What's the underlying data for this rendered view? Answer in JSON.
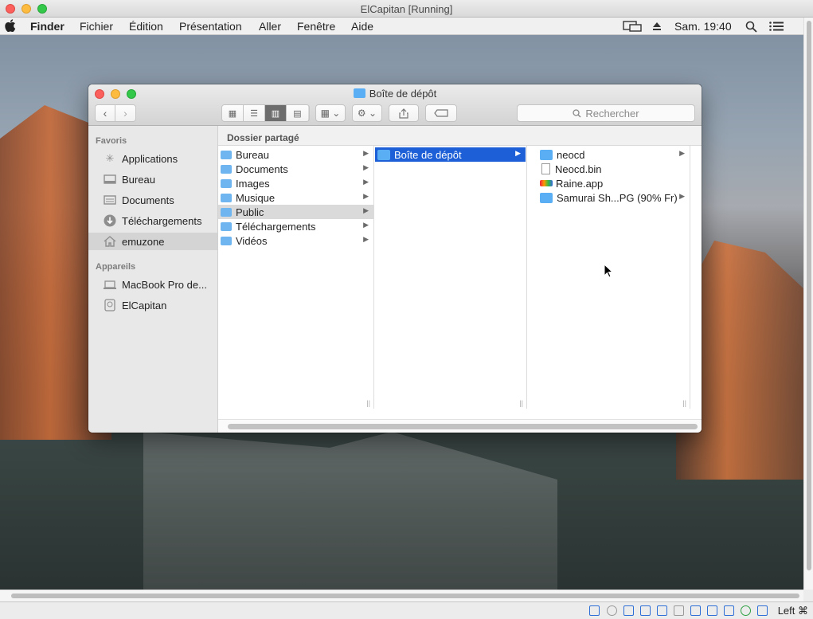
{
  "host": {
    "title": "ElCapitan [Running]",
    "host_key": "Left ⌘"
  },
  "menubar": {
    "app_name": "Finder",
    "items": [
      "Fichier",
      "Édition",
      "Présentation",
      "Aller",
      "Fenêtre",
      "Aide"
    ],
    "clock": "Sam. 19:40"
  },
  "window": {
    "title": "Boîte de dépôt",
    "search_placeholder": "Rechercher",
    "view_mode": "columns",
    "path_header": "Dossier partagé"
  },
  "sidebar": {
    "favorites_header": "Favoris",
    "favorites": [
      {
        "label": "Applications",
        "icon": "applications-icon"
      },
      {
        "label": "Bureau",
        "icon": "desktop-icon"
      },
      {
        "label": "Documents",
        "icon": "documents-icon"
      },
      {
        "label": "Téléchargements",
        "icon": "downloads-icon"
      },
      {
        "label": "emuzone",
        "icon": "home-icon",
        "selected": true
      }
    ],
    "devices_header": "Appareils",
    "devices": [
      {
        "label": "MacBook Pro de...",
        "icon": "laptop-icon"
      },
      {
        "label": "ElCapitan",
        "icon": "disk-icon"
      }
    ]
  },
  "columns": {
    "col1": [
      "Bureau",
      "Documents",
      "Images",
      "Musique",
      "Public",
      "Téléchargements",
      "Vidéos"
    ],
    "col1_highlighted": "Public",
    "col2": [
      "Boîte de dépôt"
    ],
    "col3": [
      {
        "label": "neocd",
        "kind": "folder",
        "has_children": true
      },
      {
        "label": "Neocd.bin",
        "kind": "file",
        "has_children": false
      },
      {
        "label": "Raine.app",
        "kind": "app",
        "has_children": false
      },
      {
        "label": "Samurai Sh...PG (90% Fr)",
        "kind": "folder",
        "has_children": true
      }
    ]
  },
  "colors": {
    "selection": "#1c5fd6",
    "folder": "#5aaef3"
  }
}
